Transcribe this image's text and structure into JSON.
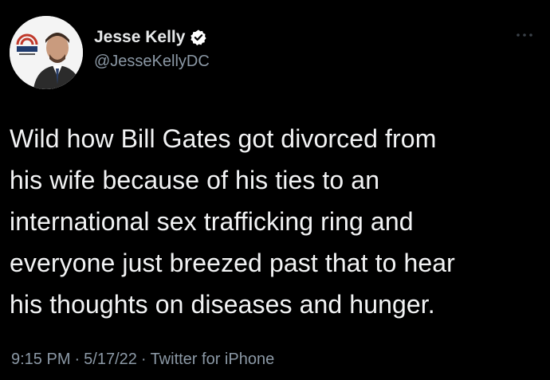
{
  "author": {
    "display_name": "Jesse Kelly",
    "handle": "@JesseKellyDC",
    "verified": true,
    "avatar_icon": "profile-photo"
  },
  "tweet": {
    "text_lines": [
      "Wild how Bill Gates got divorced from",
      "his wife because of his ties to an",
      "international sex trafficking ring and",
      "everyone just breezed past that to hear",
      "his thoughts on diseases and hunger."
    ]
  },
  "meta": {
    "time": "9:15 PM",
    "date": "5/17/22",
    "source": "Twitter for iPhone",
    "separator": "·"
  },
  "icons": {
    "more": "more-options-icon",
    "verified": "verified-badge-icon"
  },
  "colors": {
    "background": "#000000",
    "text": "#e7e9ea",
    "secondary_text": "#8b98a5",
    "verified_badge": "#ffffff"
  }
}
